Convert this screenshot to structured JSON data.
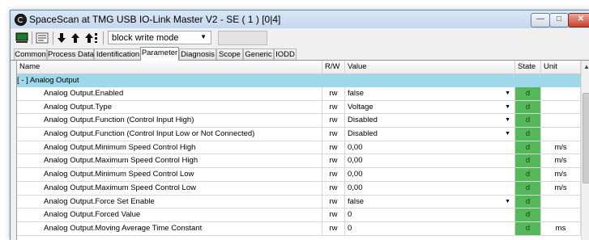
{
  "window": {
    "title": "SpaceScan at TMG USB IO-Link Master V2 - SE ( 1 ) [0|4]",
    "controls": {
      "minimize": "—",
      "maximize": "□",
      "close": "✕"
    }
  },
  "toolbar": {
    "mode_select": "block write mode",
    "icons": [
      "monitor-icon",
      "list-icon",
      "arrow-down-icon",
      "arrow-up-icon",
      "arrow-up-all-icon"
    ]
  },
  "tabs": [
    "Common",
    "Process Data",
    "Identification",
    "Parameter",
    "Diagnosis",
    "Scope",
    "Generic",
    "IODD"
  ],
  "active_tab": "Parameter",
  "table": {
    "headers": {
      "name": "Name",
      "rw": "R/W",
      "value": "Value",
      "state": "State",
      "unit": "Unit"
    },
    "group": "[ - ]  Analog Output",
    "state_color": "#55b85a",
    "group_color": "#9fd8e8",
    "rows": [
      {
        "name": "Analog Output.Enabled",
        "rw": "rw",
        "value": "false",
        "dropdown": true,
        "state": "d",
        "unit": ""
      },
      {
        "name": "Analog Output.Type",
        "rw": "rw",
        "value": "Voltage",
        "dropdown": true,
        "state": "d",
        "unit": ""
      },
      {
        "name": "Analog Output.Function (Control Input High)",
        "rw": "rw",
        "value": "Disabled",
        "dropdown": true,
        "state": "d",
        "unit": ""
      },
      {
        "name": "Analog Output.Function (Control Input Low or Not Connected)",
        "rw": "rw",
        "value": "Disabled",
        "dropdown": true,
        "state": "d",
        "unit": ""
      },
      {
        "name": "Analog Output.Minimum Speed Control High",
        "rw": "rw",
        "value": "0,00",
        "dropdown": false,
        "state": "d",
        "unit": "m/s"
      },
      {
        "name": "Analog Output.Maximum Speed Control High",
        "rw": "rw",
        "value": "0,00",
        "dropdown": false,
        "state": "d",
        "unit": "m/s"
      },
      {
        "name": "Analog Output.Minimum Speed Control Low",
        "rw": "rw",
        "value": "0,00",
        "dropdown": false,
        "state": "d",
        "unit": "m/s"
      },
      {
        "name": "Analog Output.Maximum Speed Control Low",
        "rw": "rw",
        "value": "0,00",
        "dropdown": false,
        "state": "d",
        "unit": "m/s"
      },
      {
        "name": "Analog Output.Force Set Enable",
        "rw": "rw",
        "value": "false",
        "dropdown": true,
        "state": "d",
        "unit": ""
      },
      {
        "name": "Analog Output.Forced Value",
        "rw": "rw",
        "value": "0",
        "dropdown": false,
        "state": "d",
        "unit": ""
      },
      {
        "name": "Analog Output.Moving Average Time Constant",
        "rw": "rw",
        "value": "0",
        "dropdown": false,
        "state": "d",
        "unit": "ms"
      }
    ]
  }
}
